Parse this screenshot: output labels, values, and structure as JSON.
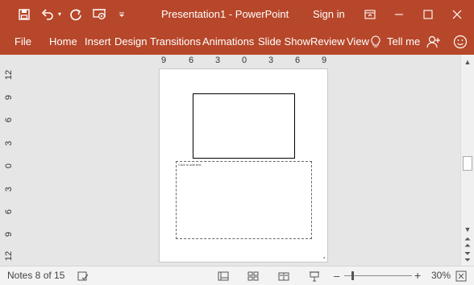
{
  "titlebar": {
    "title": "Presentation1  -  PowerPoint",
    "sign_in": "Sign in",
    "icons": [
      "save-icon",
      "undo-icon",
      "undo-dropdown-icon",
      "redo-icon",
      "present-from-beginning-icon",
      "customize-qat-icon",
      "ribbon-display-options-icon",
      "minimize-icon",
      "maximize-icon",
      "close-icon"
    ]
  },
  "ribbon": {
    "tabs": [
      "File",
      "Home",
      "Insert",
      "Design",
      "Transitions",
      "Animations",
      "Slide Show",
      "Review",
      "View"
    ],
    "tell_me": "Tell me",
    "icons": [
      "lightbulb-icon",
      "share-icon",
      "smiley-icon"
    ]
  },
  "ruler": {
    "horizontal": [
      "9",
      "6",
      "3",
      "0",
      "3",
      "6",
      "9"
    ],
    "vertical": [
      "12",
      "9",
      "6",
      "3",
      "0",
      "3",
      "6",
      "9",
      "12"
    ]
  },
  "notes_page": {
    "placeholder": "Click to add text"
  },
  "statusbar": {
    "slide_info": "Notes 8 of 15",
    "zoom": "30%",
    "minus": "–",
    "plus": "+",
    "icons": [
      "accessibility-icon",
      "normal-view-icon",
      "slide-sorter-icon",
      "reading-view-icon",
      "slide-show-icon",
      "fit-slide-icon"
    ]
  },
  "colors": {
    "accent": "#b7472a",
    "status_bg": "#f3f3f3",
    "workspace_bg": "#e6e6e6"
  }
}
